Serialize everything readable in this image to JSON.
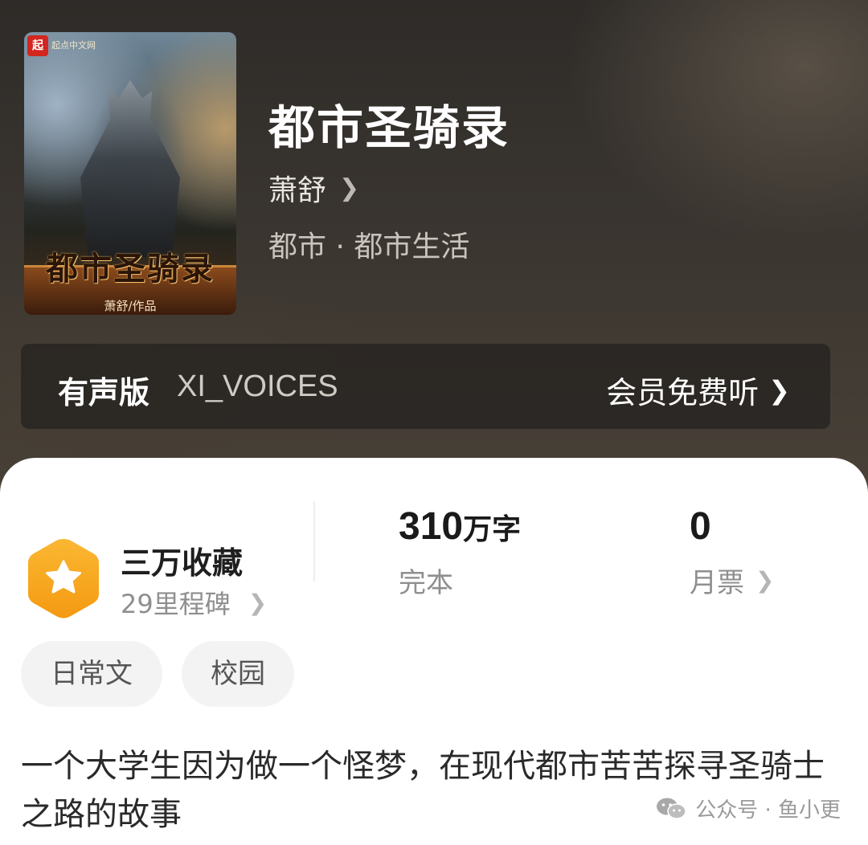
{
  "book": {
    "title": "都市圣骑录",
    "author": "萧舒",
    "genre": "都市 · 都市生活",
    "cover": {
      "badge": "起",
      "publisher": "起点中文网",
      "title": "都市圣骑录",
      "author_line": "萧舒/作品"
    }
  },
  "audio": {
    "label": "有声版",
    "voices": "XI_VOICES",
    "action": "会员免费听"
  },
  "stats": {
    "favorites": "三万收藏",
    "milestones": "29里程碑",
    "word_count": "310",
    "word_unit": "万字",
    "status": "完本",
    "monthly_votes": "0",
    "monthly_votes_label": "月票"
  },
  "tags": [
    "日常文",
    "校园"
  ],
  "description": "一个大学生因为做一个怪梦，在现代都市苦苦探寻圣骑士之路的故事",
  "watermark": "公众号 · 鱼小更",
  "colors": {
    "badge_orange": "#f7a71f",
    "card_bg": "#ffffff",
    "header_bg": "#3a3633"
  },
  "icons": {
    "chevron": "chevron-right-icon",
    "badge": "star-hexagon-icon",
    "wechat": "wechat-icon"
  }
}
